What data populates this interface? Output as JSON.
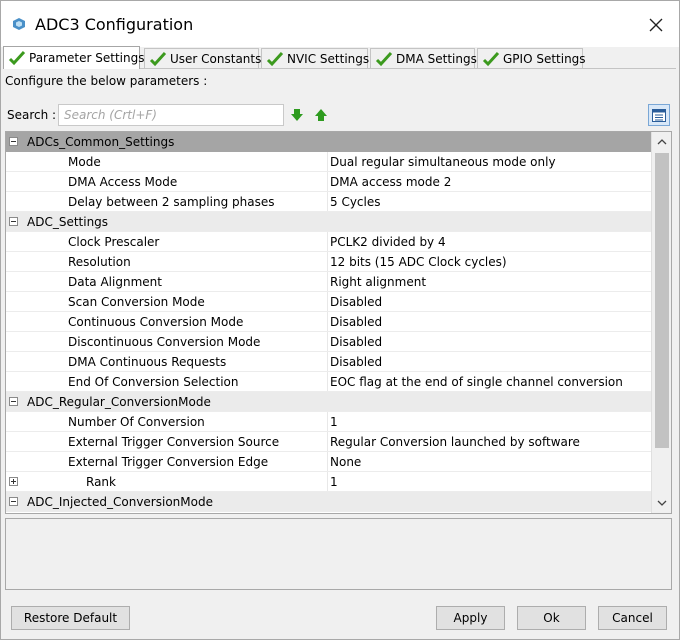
{
  "window": {
    "title": "ADC3 Configuration"
  },
  "tabs": [
    {
      "label": "Parameter Settings"
    },
    {
      "label": "User Constants"
    },
    {
      "label": "NVIC Settings"
    },
    {
      "label": "DMA Settings"
    },
    {
      "label": "GPIO Settings"
    }
  ],
  "configure_label": "Configure the below parameters :",
  "search": {
    "label": "Search :",
    "placeholder": "Search (Crtl+F)"
  },
  "groups": [
    {
      "label": "ADCs_Common_Settings",
      "params": [
        {
          "name": "Mode",
          "value": "Dual regular simultaneous mode only"
        },
        {
          "name": "DMA Access Mode",
          "value": "DMA access mode 2"
        },
        {
          "name": "Delay between 2 sampling phases",
          "value": "5 Cycles"
        }
      ]
    },
    {
      "label": "ADC_Settings",
      "params": [
        {
          "name": "Clock Prescaler",
          "value": "PCLK2 divided by 4"
        },
        {
          "name": "Resolution",
          "value": "12 bits (15 ADC Clock cycles)"
        },
        {
          "name": "Data Alignment",
          "value": "Right alignment"
        },
        {
          "name": "Scan Conversion Mode",
          "value": "Disabled"
        },
        {
          "name": "Continuous Conversion Mode",
          "value": "Disabled"
        },
        {
          "name": "Discontinuous Conversion Mode",
          "value": "Disabled"
        },
        {
          "name": "DMA Continuous Requests",
          "value": "Disabled"
        },
        {
          "name": "End Of Conversion Selection",
          "value": "EOC flag at the end of single channel conversion"
        }
      ]
    },
    {
      "label": "ADC_Regular_ConversionMode",
      "params": [
        {
          "name": "Number Of Conversion",
          "value": "1"
        },
        {
          "name": "External Trigger Conversion Source",
          "value": "Regular Conversion launched by software"
        },
        {
          "name": "External Trigger Conversion Edge",
          "value": "None"
        },
        {
          "name": "Rank",
          "value": "1"
        }
      ]
    },
    {
      "label": "ADC_Injected_ConversionMode"
    }
  ],
  "buttons": {
    "restore_default": "Restore Default",
    "apply": "Apply",
    "ok": "Ok",
    "cancel": "Cancel"
  },
  "colors": {
    "check": "#3c9a1e",
    "arrow": "#2e9b1f",
    "header_row": "#a5a5a5",
    "group_row": "#ebebeb"
  },
  "icons": {
    "app": "stm32-cube-icon",
    "tab_status": "checkmark-icon",
    "search_next": "arrow-down-icon",
    "search_prev": "arrow-up-icon",
    "view_toggle": "list-view-icon"
  }
}
